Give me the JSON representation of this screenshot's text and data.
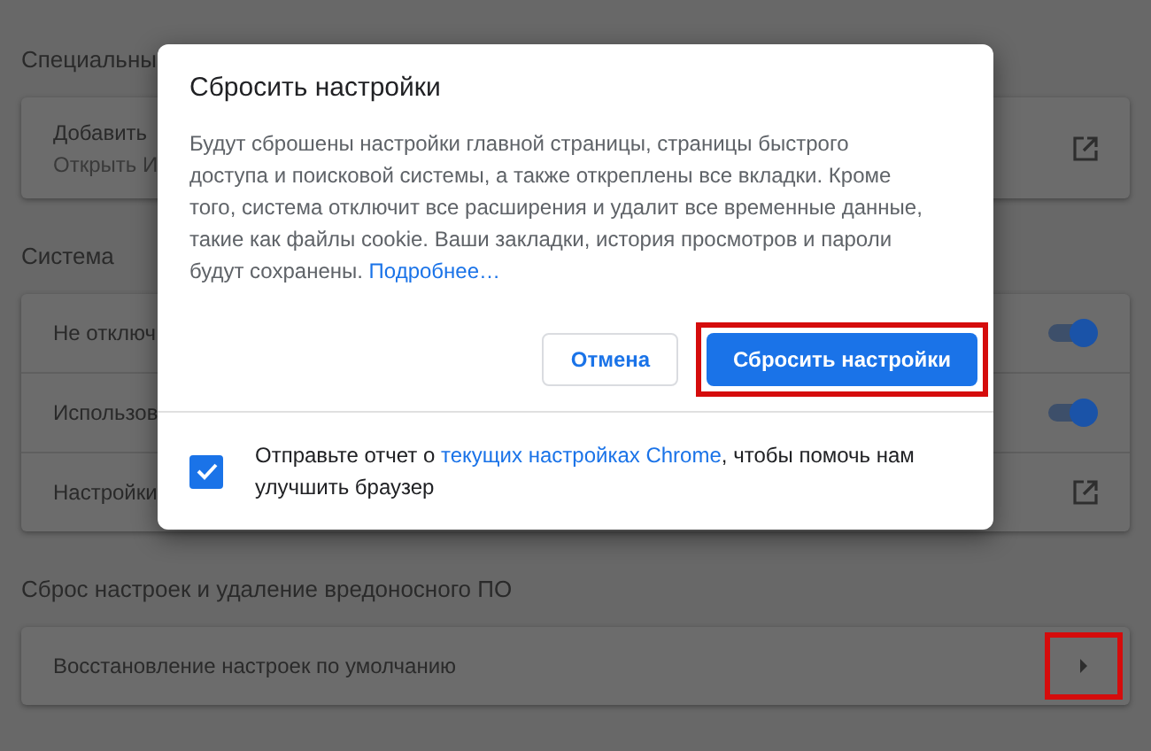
{
  "sections": [
    {
      "title": "Специальны",
      "rows": [
        {
          "kind": "link",
          "title": "Добавить",
          "subtitle": "Открыть И"
        }
      ]
    },
    {
      "title": "Система",
      "rows": [
        {
          "kind": "toggle",
          "title": "Не отключ",
          "on": true
        },
        {
          "kind": "toggle",
          "title": "Использов",
          "on": true
        },
        {
          "kind": "link",
          "title": "Настройки"
        }
      ]
    },
    {
      "title": "Сброс настроек и удаление вредоносного ПО",
      "rows": [
        {
          "kind": "arrow",
          "title": "Восстановление настроек по умолчанию",
          "highlighted": true
        }
      ]
    }
  ],
  "dialog": {
    "title": "Сбросить настройки",
    "body": "Будут сброшены настройки главной страницы, страницы быстрого доступа и поисковой системы, а также откреплены все вкладки. Кроме того, система отключит все расширения и удалит все временные данные, такие как файлы cookie. Ваши закладки, история просмотров и пароли будут сохранены.",
    "learn_more": "Подробнее…",
    "buttons": [
      {
        "kind": "secondary",
        "label": "Отмена",
        "highlighted": false
      },
      {
        "kind": "primary",
        "label": "Сбросить настройки",
        "highlighted": true
      }
    ],
    "report": {
      "checked": true,
      "before": "Отправьте отчет о ",
      "link": "текущих настройках Chrome",
      "after": ", чтобы помочь нам улучшить браузер"
    }
  }
}
